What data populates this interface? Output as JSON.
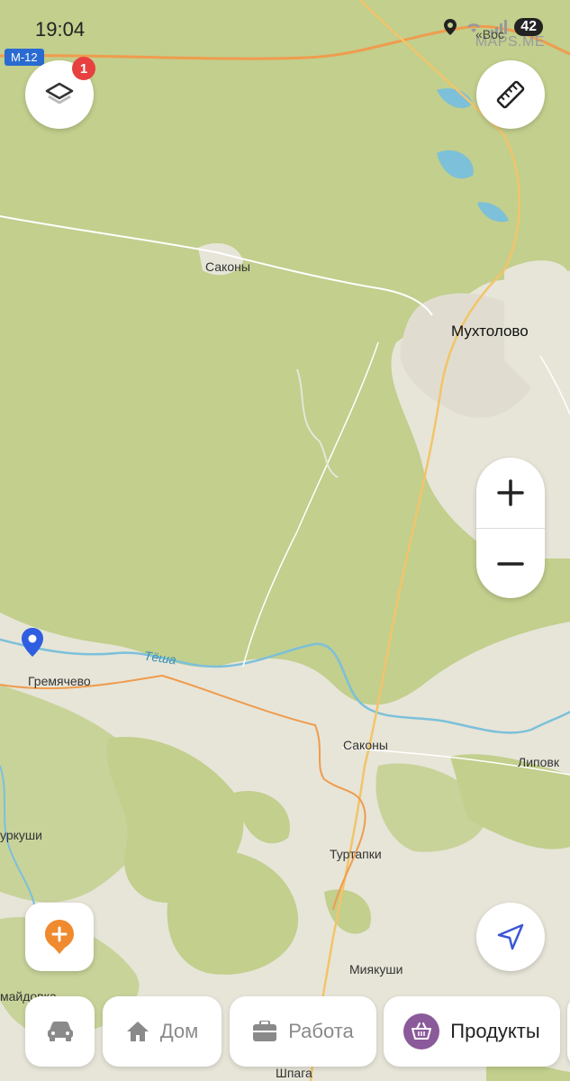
{
  "status_bar": {
    "time": "19:04",
    "battery": "42"
  },
  "watermark": "MAPS.ME",
  "road_badge": "M-12",
  "top_road_label": "«Вос",
  "layers_badge_count": "1",
  "map_labels": {
    "sakony_top": "Саконы",
    "mukhtolovo": "Мухтолово",
    "tesha": "Тёша",
    "gremyachevo": "Гремячево",
    "sakony_bottom": "Саконы",
    "lipovka": "Липовк",
    "churkushi": "уркуши",
    "turtapki": "Туртапки",
    "myakushi": "Миякуши",
    "maydovka": "майдовка",
    "shpaga": "Шпага"
  },
  "bottom_bar": {
    "home_label": "Дом",
    "work_label": "Работа",
    "products_label": "Продукты"
  },
  "colors": {
    "forest": "#c2cf8d",
    "land": "#e7e5d8",
    "road_orange": "#ef9c4e",
    "river": "#7cc0da",
    "accent_orange": "#f08a2e",
    "nav_blue": "#3b57d6",
    "products_purple": "#8a5a9a"
  }
}
